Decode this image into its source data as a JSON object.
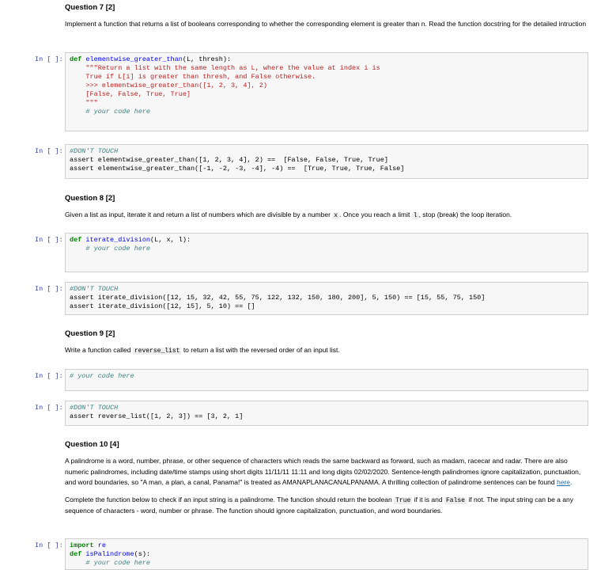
{
  "q7": {
    "title": "Question 7 [2]",
    "desc": "Implement a function that returns a list of booleans corresponding to whether the corresponding element is greater than n. Read the function docstring for the detailed intruction"
  },
  "cell1": {
    "prompt": "In [ ]:",
    "lines": [
      "def elementwise_greater_than(L, thresh):",
      "    \"\"\"Return a list with the same length as L, where the value at index i is",
      "    True if L[i] is greater than thresh, and False otherwise.",
      "",
      "    >>> elementwise_greater_than([1, 2, 3, 4], 2)",
      "    [False, False, True, True]",
      "    \"\"\"",
      "    # your code here"
    ]
  },
  "cell2": {
    "prompt": "In [ ]:",
    "lines": [
      "#DON'T TOUCH",
      "assert elementwise_greater_than([1, 2, 3, 4], 2) ==  [False, False, True, True]",
      "assert elementwise_greater_than([-1, -2, -3, -4], -4) ==  [True, True, True, False]"
    ]
  },
  "q8": {
    "title": "Question 8 [2]",
    "desc_a": "Given a list as input, iterate it and return a list of numbers which are divisible by a number ",
    "code_a": "x",
    "desc_b": ". Once you reach a limit ",
    "code_b": "l",
    "desc_c": ", stop (break) the loop iteration."
  },
  "cell3": {
    "prompt": "In [ ]:",
    "lines": [
      "def iterate_division(L, x, l):",
      "    # your code here"
    ]
  },
  "cell4": {
    "prompt": "In [ ]:",
    "lines": [
      "#DON'T TOUCH",
      "assert iterate_division([12, 15, 32, 42, 55, 75, 122, 132, 150, 180, 200], 5, 150) == [15, 55, 75, 150]",
      "assert iterate_division([12, 15], 5, 10) == []"
    ]
  },
  "q9": {
    "title": "Question 9 [2]",
    "desc_a": "Write a function called ",
    "code_a": "reverse_list",
    "desc_b": " to return a list with the reversed order of an input list."
  },
  "cell5": {
    "prompt": "In [ ]:",
    "lines": [
      "# your code here"
    ]
  },
  "cell6": {
    "prompt": "In [ ]:",
    "lines": [
      "#DON'T TOUCH",
      "assert reverse_list([1, 2, 3]) == [3, 2, 1]"
    ]
  },
  "q10": {
    "title": "Question 10 [4]",
    "para1": "A palindrome is a word, number, phrase, or other sequence of characters which reads the same backward as forward, such as madam, racecar and radar. There are also numeric palindromes, including date/time stamps using short digits 11/11/11 11:11 and long digits 02/02/2020. Sentence-length palindromes ignore capitalization, punctuation, and word boundaries, so \"A man, a plan, a canal, Panama!\" is treated as AMANAPLANACANALPANAMA. A thrilling collection of palindrome sentences can be found ",
    "link": "here",
    "para1_end": ".",
    "para2_a": "Complete the function below to check if an input string is a palindrome. The function should return the boolean ",
    "code_true": "True",
    "para2_b": " if it is and ",
    "code_false": "False",
    "para2_c": " if not. The input string can be a any sequence of characters - word, number or phrase. The function should ignore capitalization, punctuation, and word boundaries."
  },
  "cell7": {
    "prompt": "In [ ]:",
    "lines": [
      "import re",
      "def isPalindrome(s):",
      "    # your code here"
    ]
  }
}
